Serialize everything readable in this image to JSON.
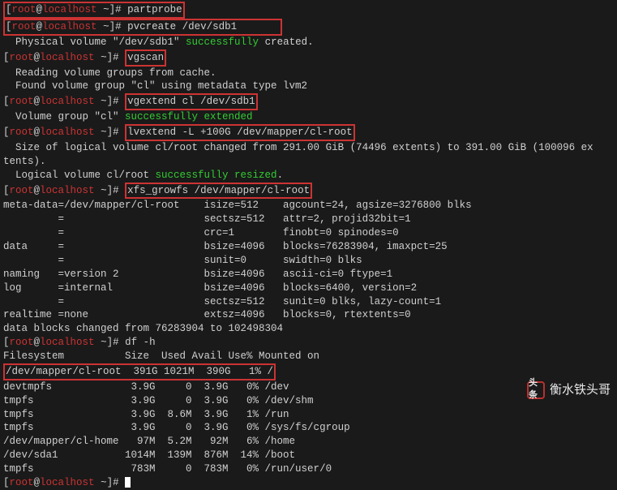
{
  "prompt": {
    "user": "root",
    "host": "localhost",
    "dir": "~",
    "end": "#"
  },
  "cmds": {
    "partprobe": "partprobe",
    "pvcreate": "pvcreate /dev/sdb1",
    "vgscan": "vgscan",
    "vgextend": "vgextend cl /dev/sdb1",
    "lvextend": "lvextend -L +100G /dev/mapper/cl-root",
    "xfs": "xfs_growfs /dev/mapper/cl-root",
    "df": "df -h"
  },
  "out": {
    "pv1a": "  Physical volume \"/dev/sdb1\" ",
    "pv1b": "successfully",
    "pv1c": " created.",
    "vgs1": "  Reading volume groups from cache.",
    "vgs2a": "  Found volume group \"cl\" using metadata type lvm2",
    "vge1a": "  Volume group \"cl\" ",
    "vge1b": "successfully extended",
    "lv1": "  Size of logical volume cl/root changed from 291.00 GiB (74496 extents) to 391.00 GiB (100096 ex",
    "lv1b": "tents).",
    "lv2a": "  Logical volume cl/root ",
    "lv2b": "successfully resized",
    "lv2c": ".",
    "xfs_rows": [
      "meta-data=/dev/mapper/cl-root    isize=512    agcount=24, agsize=3276800 blks",
      "         =                       sectsz=512   attr=2, projid32bit=1",
      "         =                       crc=1        finobt=0 spinodes=0",
      "data     =                       bsize=4096   blocks=76283904, imaxpct=25",
      "         =                       sunit=0      swidth=0 blks",
      "naming   =version 2              bsize=4096   ascii-ci=0 ftype=1",
      "log      =internal               bsize=4096   blocks=6400, version=2",
      "         =                       sectsz=512   sunit=0 blks, lazy-count=1",
      "realtime =none                   extsz=4096   blocks=0, rtextents=0",
      "data blocks changed from 76283904 to 102498304"
    ],
    "df_header": "Filesystem          Size  Used Avail Use% Mounted on",
    "df_rows": [
      "/dev/mapper/cl-root  391G 1021M  390G   1% /",
      "devtmpfs             3.9G     0  3.9G   0% /dev",
      "tmpfs                3.9G     0  3.9G   0% /dev/shm",
      "tmpfs                3.9G  8.6M  3.9G   1% /run",
      "tmpfs                3.9G     0  3.9G   0% /sys/fs/cgroup",
      "/dev/mapper/cl-home   97M  5.2M   92M   6% /home",
      "/dev/sda1           1014M  139M  876M  14% /boot",
      "tmpfs                783M     0  783M   0% /run/user/0"
    ]
  },
  "watermark": {
    "logo": "头条",
    "text": "衡水铁头哥"
  }
}
